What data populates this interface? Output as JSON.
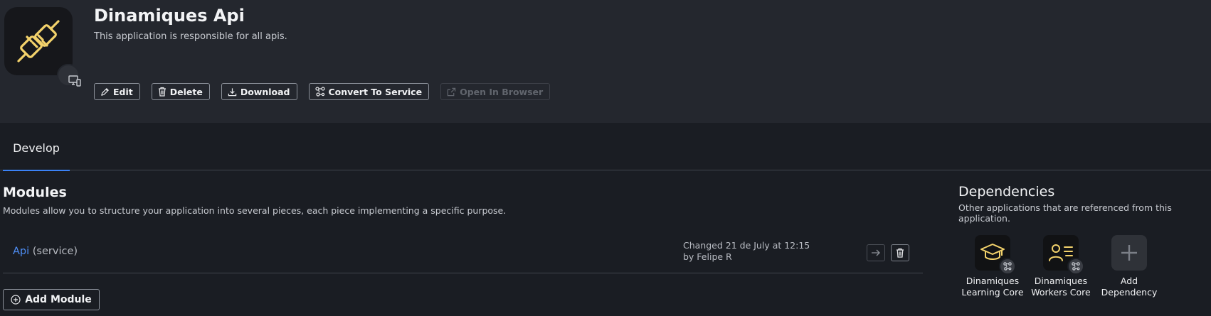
{
  "app": {
    "title": "Dinamiques Api",
    "description": "This application is responsible for all apis.",
    "icon": "plug-icon",
    "accent_color": "#f3d26b"
  },
  "toolbar": {
    "edit_label": "Edit",
    "delete_label": "Delete",
    "download_label": "Download",
    "convert_label": "Convert To Service",
    "open_label": "Open In Browser"
  },
  "tabs": [
    {
      "label": "Develop",
      "active": true
    }
  ],
  "modules": {
    "title": "Modules",
    "description": "Modules allow you to structure your application into several pieces, each piece implementing a specific purpose.",
    "items": [
      {
        "name": "Api",
        "type": "(service)",
        "changed": "Changed 21 de July at 12:15",
        "by": "by Felipe R"
      }
    ],
    "add_label": "Add Module"
  },
  "dependencies": {
    "title": "Dependencies",
    "description": "Other applications that are referenced from this application.",
    "items": [
      {
        "line1": "Dinamiques",
        "line2": "Learning Core",
        "icon": "graduation-cap-icon"
      },
      {
        "line1": "Dinamiques",
        "line2": "Workers Core",
        "icon": "user-list-icon"
      }
    ],
    "add_line1": "Add",
    "add_line2": "Dependency"
  },
  "colors": {
    "link": "#4f8ff7",
    "tab_underline": "#3b82f6",
    "header_bg": "#24272e",
    "page_bg": "#1a1d23"
  }
}
